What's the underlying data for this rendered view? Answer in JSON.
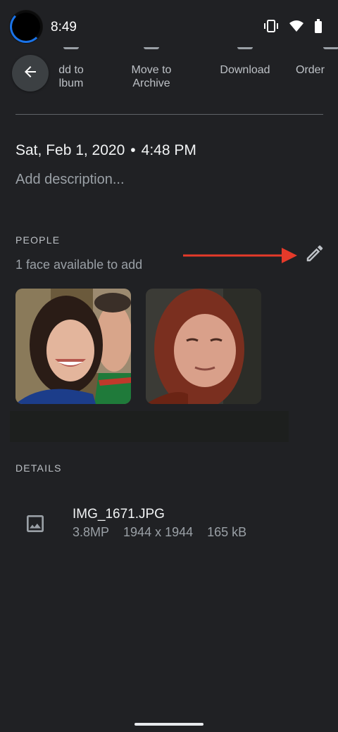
{
  "status_bar": {
    "time": "8:49",
    "icons": [
      "vibrate-icon",
      "wifi-icon",
      "battery-icon"
    ]
  },
  "actions": [
    {
      "label": "Add to\nAlbum",
      "visible_label": "dd to\nlbum"
    },
    {
      "label": "Move to\nArchive"
    },
    {
      "label": "Download"
    },
    {
      "label": "Order"
    }
  ],
  "back_icon": "arrow-back-icon",
  "info": {
    "date": "Sat, Feb 1, 2020",
    "separator": "•",
    "time": "4:48 PM",
    "description_placeholder": "Add description..."
  },
  "people": {
    "label": "PEOPLE",
    "note": "1 face available to add",
    "edit_icon": "pencil-icon",
    "arrow_color": "#e53a2a",
    "faces": [
      "face-1",
      "face-2"
    ]
  },
  "details": {
    "label": "DETAILS",
    "file_icon": "image-icon",
    "file_name": "IMG_1671.JPG",
    "megapixels": "3.8MP",
    "dimensions": "1944 x 1944",
    "size": "165 kB"
  },
  "colors": {
    "background": "#202124",
    "accent": "#1a73e8"
  }
}
